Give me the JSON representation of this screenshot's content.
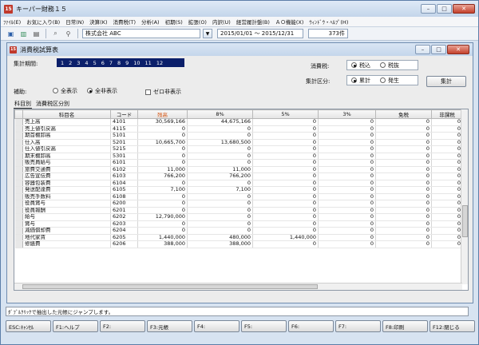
{
  "app": {
    "title": "キーパー財務１５",
    "icon": "15"
  },
  "menu": [
    "ﾌｧｲﾙ(E)",
    "お気に入り(B)",
    "日常(N)",
    "決算(K)",
    "消費税(T)",
    "分析(A)",
    "初期(S)",
    "拡張(O)",
    "内訳(U)",
    "経営履計盤(B)",
    "ＡＯ機能(X)",
    "ｳｨﾝﾄﾞｳ・ﾍﾙﾌﾟ(H)"
  ],
  "toolbar": {
    "company": "株式会社 ABC",
    "period": "2015/01/01 ～ 2015/12/31",
    "count": "373件"
  },
  "child": {
    "title": "消費税試算表",
    "period_label": "集計期間:",
    "months": [
      "1",
      "2",
      "3",
      "4",
      "5",
      "6",
      "7",
      "8",
      "9",
      "10",
      "11",
      "12"
    ],
    "tax_label": "消費税:",
    "tax_opt1": "税込",
    "tax_opt2": "税抜",
    "agg_label": "集計区分:",
    "agg_opt1": "累計",
    "agg_opt2": "発生",
    "aggregate_button": "集計",
    "aux_label": "補助:",
    "aux_opt1": "全表示",
    "aux_opt2": "全非表示",
    "zero_hide": "ゼロ非表示",
    "tab1": "科目別",
    "tab2": "消費税区分別"
  },
  "table": {
    "headers": [
      "科目名",
      "コード",
      "残高",
      "8%",
      "5%",
      "3%",
      "免税",
      "非課税"
    ],
    "rows": [
      [
        "売上高",
        "4101",
        "30,569,166",
        "44,675,166",
        "0",
        "0",
        "0",
        "0"
      ],
      [
        "売上値引戻高",
        "4115",
        "0",
        "0",
        "0",
        "0",
        "0",
        "0"
      ],
      [
        "期首棚卸高",
        "5101",
        "0",
        "0",
        "0",
        "0",
        "0",
        "0"
      ],
      [
        "仕入高",
        "5201",
        "10,665,700",
        "13,680,500",
        "0",
        "0",
        "0",
        "0"
      ],
      [
        "仕入値引戻高",
        "5215",
        "0",
        "0",
        "0",
        "0",
        "0",
        "0"
      ],
      [
        "期末棚卸高",
        "5301",
        "0",
        "0",
        "0",
        "0",
        "0",
        "0"
      ],
      [
        "販売員給与",
        "6101",
        "0",
        "0",
        "0",
        "0",
        "0",
        "0"
      ],
      [
        "旅費交通費",
        "6102",
        "11,000",
        "11,000",
        "0",
        "0",
        "0",
        "0"
      ],
      [
        "広告宣伝費",
        "6103",
        "766,200",
        "766,200",
        "0",
        "0",
        "0",
        "0"
      ],
      [
        "容器包装費",
        "6104",
        "0",
        "0",
        "0",
        "0",
        "0",
        "0"
      ],
      [
        "発送配達費",
        "6105",
        "7,100",
        "7,100",
        "0",
        "0",
        "0",
        "0"
      ],
      [
        "販売手数料",
        "6108",
        "0",
        "0",
        "0",
        "0",
        "0",
        "0"
      ],
      [
        "役員賞与",
        "6200",
        "0",
        "0",
        "0",
        "0",
        "0",
        "0"
      ],
      [
        "役員報酬",
        "6201",
        "0",
        "0",
        "0",
        "0",
        "0",
        "0"
      ],
      [
        "給与",
        "6202",
        "12,790,000",
        "0",
        "0",
        "0",
        "0",
        "0"
      ],
      [
        "賞与",
        "6203",
        "0",
        "0",
        "0",
        "0",
        "0",
        "0"
      ],
      [
        "減価償却費",
        "6204",
        "0",
        "0",
        "0",
        "0",
        "0",
        "0"
      ],
      [
        "地代家賃",
        "6205",
        "1,440,000",
        "480,000",
        "1,440,000",
        "0",
        "0",
        "0"
      ],
      [
        "修繕費",
        "6206",
        "388,000",
        "388,000",
        "0",
        "0",
        "0",
        "0"
      ]
    ]
  },
  "status": "ﾀﾞﾌﾞﾙｸﾘｯｸで抽出した元帳にジャンプします。",
  "fkeys": [
    "ESC:ｷｬﾝｾﾙ",
    "F1:ヘルプ",
    "F2:",
    "F3:元帳",
    "F4:",
    "F5:",
    "F6:",
    "F7:",
    "F8:印刷",
    "F12:閉じる"
  ]
}
